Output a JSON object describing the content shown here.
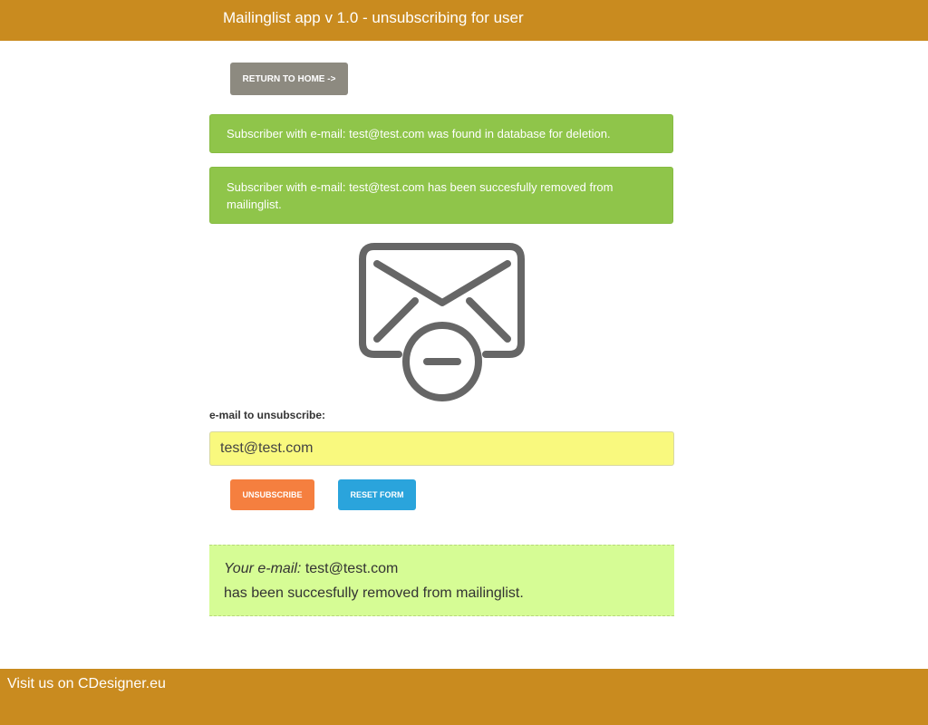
{
  "header": {
    "title": "Mailinglist app v 1.0 - unsubscribing for user"
  },
  "nav": {
    "home_label": "RETURN TO HOME ->"
  },
  "alerts": [
    "Subscriber with e-mail: test@test.com was found in database for deletion.",
    "Subscriber with e-mail: test@test.com has been succesfully removed from mailinglist."
  ],
  "form": {
    "label": "e-mail to unsubscribe:",
    "email_value": "test@test.com",
    "unsubscribe_label": "UNSUBSCRIBE",
    "reset_label": "RESET FORM"
  },
  "result": {
    "label": "Your e-mail:",
    "email": "test@test.com",
    "message": "has been succesfully removed from mailinglist."
  },
  "footer": {
    "link_text": "Visit us on CDesigner.eu"
  },
  "icon": {
    "name": "mail-remove-icon",
    "color": "#666666"
  },
  "colors": {
    "brand": "#c98b1f",
    "alert_green": "#8fc54a",
    "input_yellow": "#f9f97e",
    "unsubscribe_orange": "#f57f3f",
    "reset_blue": "#2aa4dc",
    "result_green": "#d6fc95",
    "home_gray": "#8d8a80"
  }
}
